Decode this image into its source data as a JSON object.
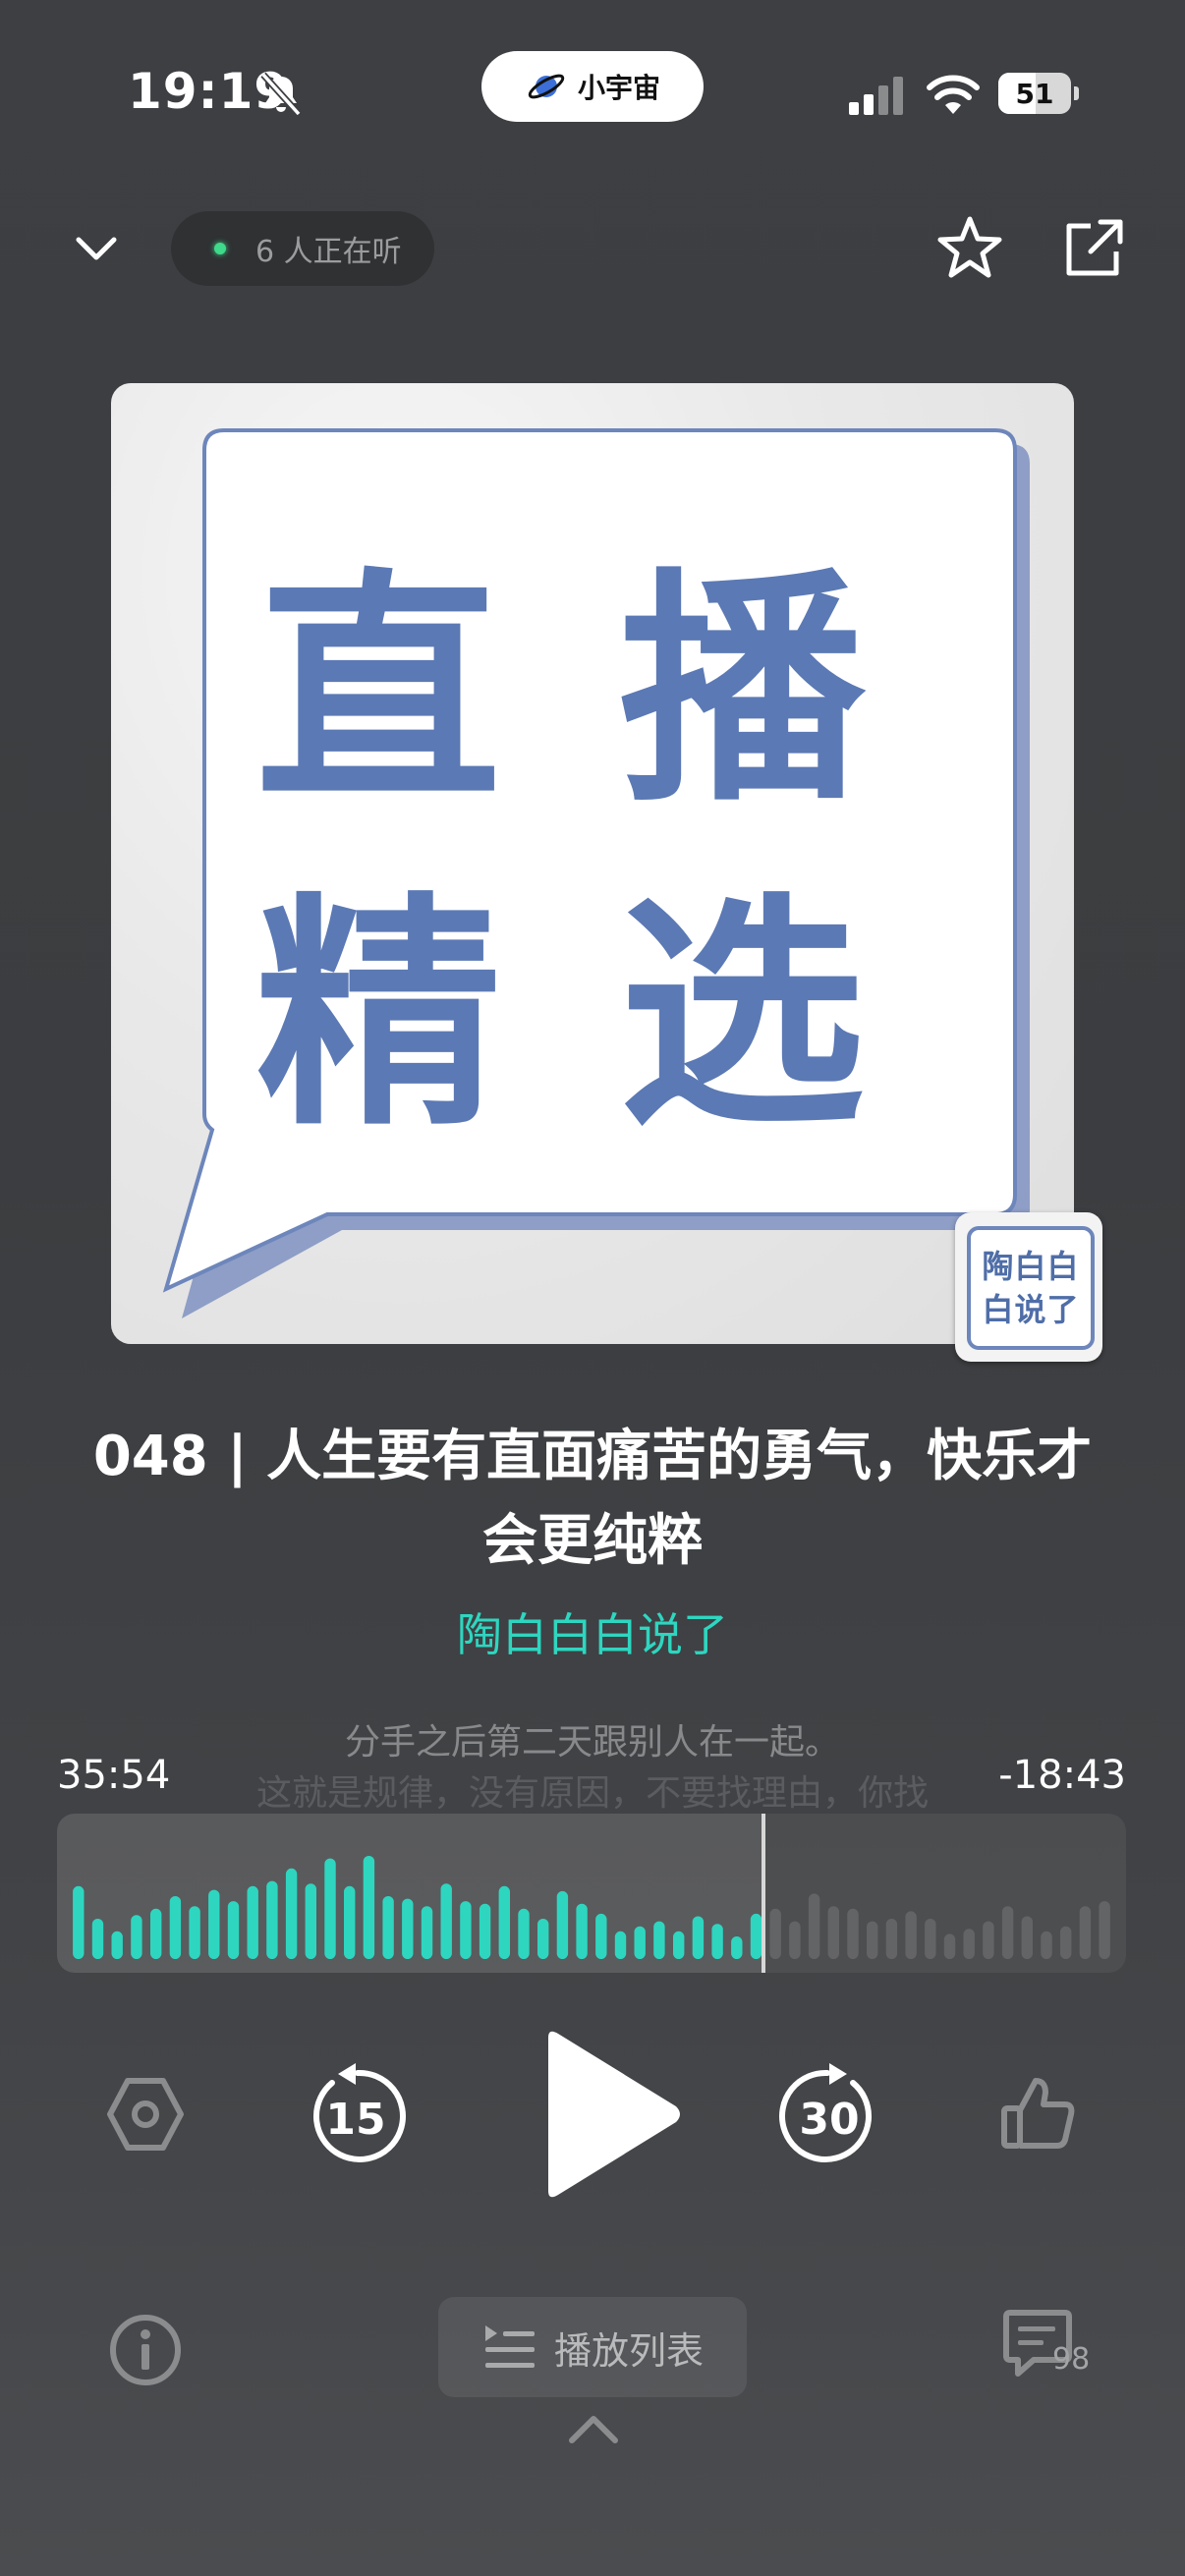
{
  "status_bar": {
    "time": "19:19",
    "app_pill_label": "小宇宙",
    "battery_level": "51",
    "battery_fraction": 0.51
  },
  "top_bar": {
    "listening_text": "6 人正在听"
  },
  "cover": {
    "line1": [
      "直",
      "播"
    ],
    "line2": [
      "精",
      "选"
    ],
    "badge_line1": "陶白白",
    "badge_line2": "白说了"
  },
  "episode": {
    "title": "048 | 人生要有直面痛苦的勇气，快乐才会更纯粹",
    "author": "陶白白白说了"
  },
  "lyrics": {
    "current": "分手之后第二天跟别人在一起。",
    "next": "这就是规律，没有原因，不要找理由，你找"
  },
  "player": {
    "elapsed": "35:54",
    "remaining": "-18:43",
    "progress_fraction": 0.659,
    "waveform": [
      0.58,
      0.32,
      0.22,
      0.35,
      0.4,
      0.5,
      0.42,
      0.55,
      0.46,
      0.58,
      0.62,
      0.72,
      0.6,
      0.8,
      0.58,
      0.82,
      0.5,
      0.48,
      0.42,
      0.6,
      0.46,
      0.44,
      0.58,
      0.4,
      0.32,
      0.54,
      0.44,
      0.36,
      0.22,
      0.26,
      0.3,
      0.22,
      0.34,
      0.28,
      0.18,
      0.36,
      0.4,
      0.3,
      0.52,
      0.42,
      0.4,
      0.3,
      0.32,
      0.38,
      0.32,
      0.2,
      0.24,
      0.3,
      0.42,
      0.34,
      0.22,
      0.26,
      0.42,
      0.46
    ],
    "played_color": "#2ed6c0",
    "unplayed_color": "rgba(255,255,255,0.13)",
    "rewind_seconds": "15",
    "forward_seconds": "30"
  },
  "bottom_bar": {
    "playlist_label": "播放列表",
    "comment_count": "98"
  }
}
